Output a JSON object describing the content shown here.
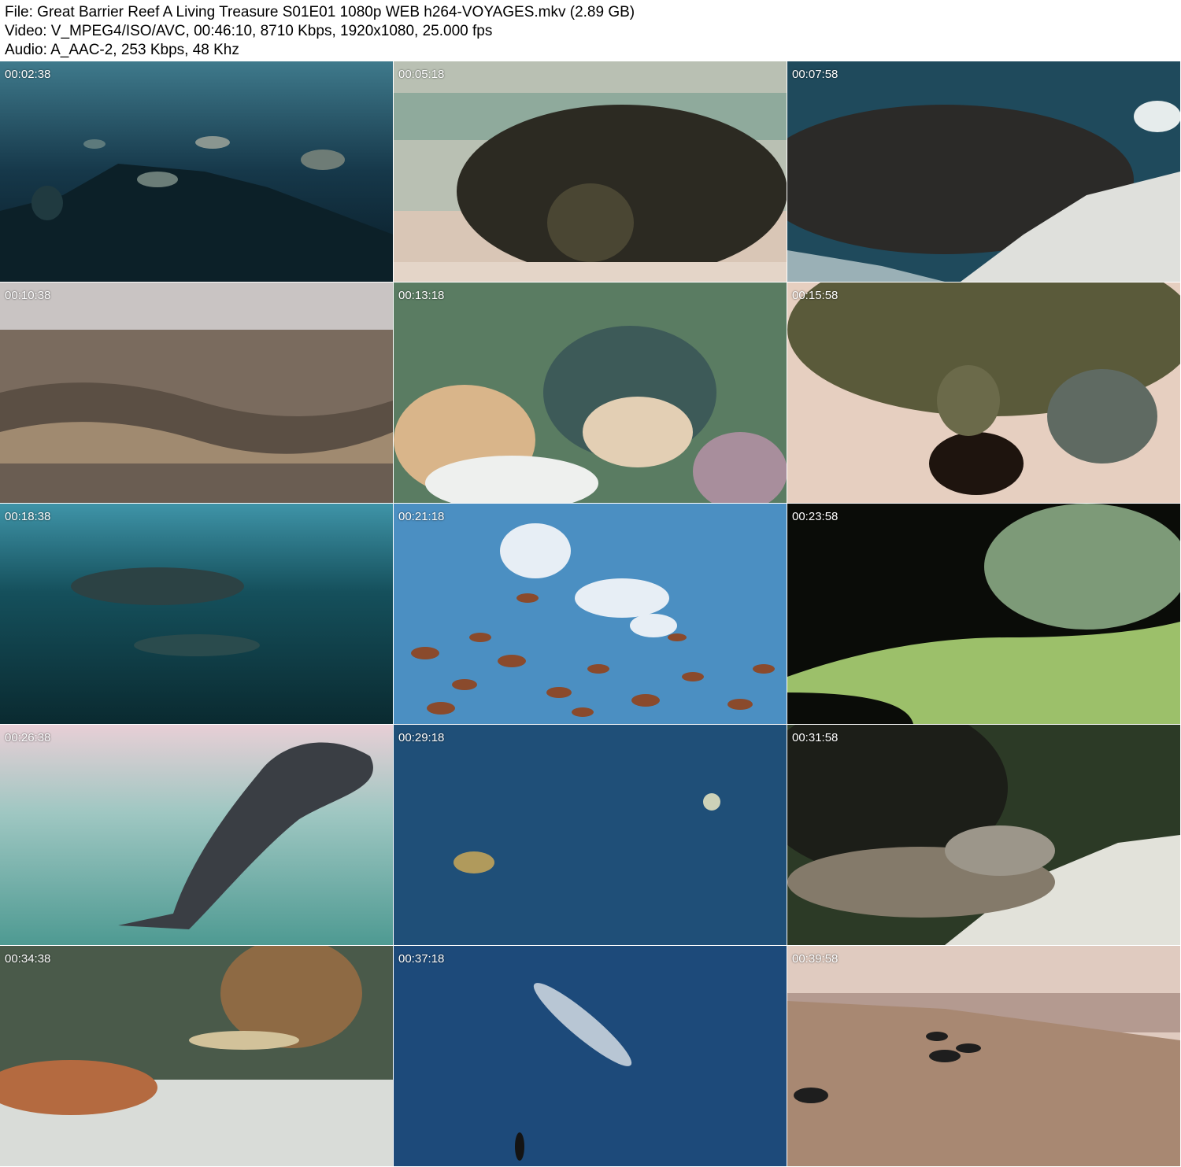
{
  "header": {
    "file": "File: Great Barrier Reef A Living Treasure S01E01 1080p WEB h264-VOYAGES.mkv (2.89 GB)",
    "video": "Video: V_MPEG4/ISO/AVC, 00:46:10, 8710 Kbps, 1920x1080, 25.000 fps",
    "audio": "Audio: A_AAC-2, 253 Kbps, 48 Khz"
  },
  "thumbnails": [
    {
      "timestamp": "00:02:38"
    },
    {
      "timestamp": "00:05:18"
    },
    {
      "timestamp": "00:07:58"
    },
    {
      "timestamp": "00:10:38"
    },
    {
      "timestamp": "00:13:18"
    },
    {
      "timestamp": "00:15:58"
    },
    {
      "timestamp": "00:18:38"
    },
    {
      "timestamp": "00:21:18"
    },
    {
      "timestamp": "00:23:58"
    },
    {
      "timestamp": "00:26:38"
    },
    {
      "timestamp": "00:29:18"
    },
    {
      "timestamp": "00:31:58"
    },
    {
      "timestamp": "00:34:38"
    },
    {
      "timestamp": "00:37:18"
    },
    {
      "timestamp": "00:39:58"
    }
  ]
}
